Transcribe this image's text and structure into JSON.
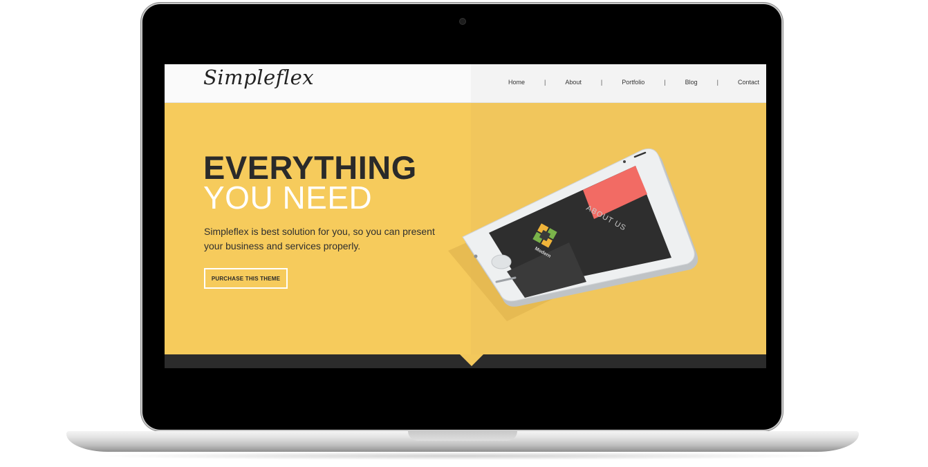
{
  "site": {
    "logo": "Simpleflex"
  },
  "nav": {
    "items": [
      {
        "label": "Home"
      },
      {
        "label": "About"
      },
      {
        "label": "Portfolio"
      },
      {
        "label": "Blog"
      },
      {
        "label": "Contact"
      }
    ],
    "separator": "|"
  },
  "hero": {
    "headline_line1": "EVERYTHING",
    "headline_line2": "YOU NEED",
    "subtext": "Simpleflex is best solution for you, so you can present your business and services properly.",
    "cta_label": "PURCHASE THIS THEME"
  },
  "phone_screen": {
    "heading": "ABOUT US",
    "tile_label": "Modern"
  },
  "colors": {
    "hero_bg": "#f6cb5c",
    "hero_bg_right": "#f1c65c",
    "accent": "#f26b64",
    "dark": "#2b2b2b"
  },
  "icons": [
    "camera-icon",
    "cycle-logo-icon"
  ]
}
